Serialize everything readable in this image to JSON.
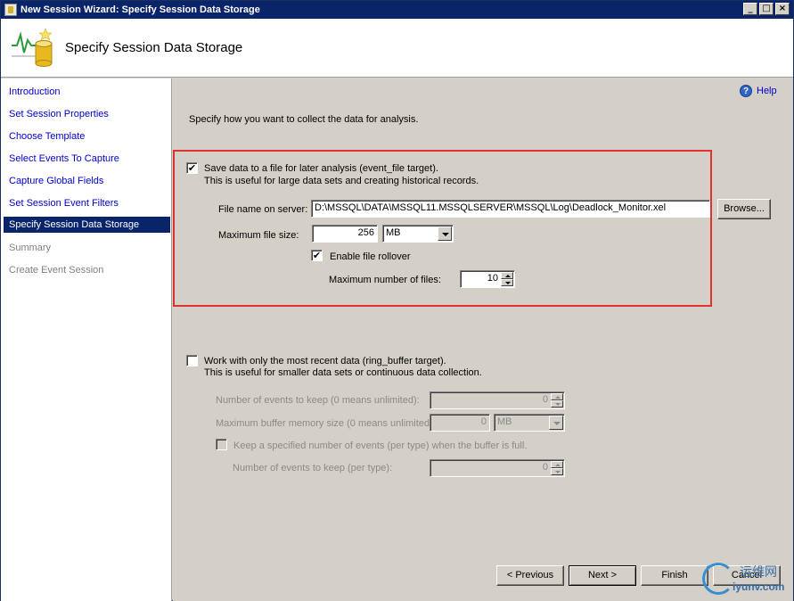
{
  "window": {
    "title": "New Session Wizard: Specify Session Data Storage",
    "controls": [
      "_",
      "□",
      "×"
    ]
  },
  "header": {
    "title": "Specify Session Data Storage",
    "icon": "database-chart-icon"
  },
  "sidebar": {
    "items": [
      {
        "label": "Introduction",
        "state": "link"
      },
      {
        "label": "Set Session Properties",
        "state": "link"
      },
      {
        "label": "Choose Template",
        "state": "link"
      },
      {
        "label": "Select Events To Capture",
        "state": "link"
      },
      {
        "label": "Capture Global Fields",
        "state": "link"
      },
      {
        "label": "Set Session Event Filters",
        "state": "link"
      },
      {
        "label": "Specify Session Data Storage",
        "state": "active"
      },
      {
        "label": "Summary",
        "state": "disabled"
      },
      {
        "label": "Create Event Session",
        "state": "disabled"
      }
    ]
  },
  "help": {
    "label": "Help"
  },
  "main": {
    "intro": "Specify how you want to collect the data for analysis.",
    "file_target": {
      "checked": true,
      "label": "Save data to a file for later analysis (event_file target).",
      "description": "This is useful for large data sets and creating historical records.",
      "file_name_label": "File name on server:",
      "file_name_value": "D:\\MSSQL\\DATA\\MSSQL11.MSSQLSERVER\\MSSQL\\Log\\Deadlock_Monitor.xel",
      "browse_label": "Browse...",
      "max_size_label": "Maximum file size:",
      "max_size_value": "256",
      "max_size_unit": "MB",
      "rollover_checked": true,
      "rollover_label": "Enable file rollover",
      "max_files_label": "Maximum number of files:",
      "max_files_value": "10"
    },
    "ring_buffer": {
      "checked": false,
      "label": "Work with only the most recent data (ring_buffer target).",
      "description": "This is useful for smaller data sets or continuous data collection.",
      "events_keep_label": "Number of events to keep (0 means unlimited):",
      "events_keep_value": "0",
      "max_memory_label": "Maximum buffer memory size (0 means unlimited):",
      "max_memory_value": "0",
      "max_memory_unit": "MB",
      "per_type_checked": false,
      "per_type_label": "Keep a specified number of events (per type) when the buffer is full.",
      "per_type_count_label": "Number of events to keep (per type):",
      "per_type_count_value": "0"
    }
  },
  "footer": {
    "previous_label": "< Previous",
    "next_label": "Next >",
    "finish_label": "Finish",
    "cancel_label": "Cancel"
  },
  "watermark": {
    "line1": "运维网",
    "line2": "iyunv.com"
  },
  "colors": {
    "title_bar": "#0a246a",
    "highlight_box": "#e0322f",
    "link": "#0000cc"
  }
}
